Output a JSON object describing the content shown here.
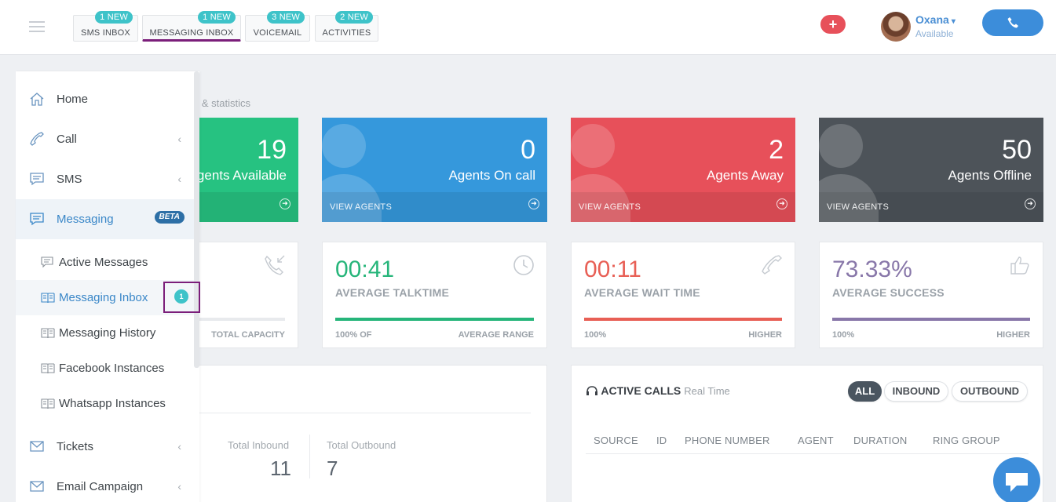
{
  "topbar": {
    "tabs": [
      {
        "label": "SMS INBOX",
        "badge": "1 NEW"
      },
      {
        "label": "MESSAGING INBOX",
        "badge": "1 NEW"
      },
      {
        "label": "VOICEMAIL",
        "badge": "3 NEW"
      },
      {
        "label": "ACTIVITIES",
        "badge": "2 NEW"
      }
    ],
    "plus": "+",
    "user": {
      "name": "Oxana",
      "status": "Available"
    }
  },
  "subtitle": "d & statistics",
  "cards": [
    {
      "value": "19",
      "label": "Agents Available",
      "color": "#26c281"
    },
    {
      "value": "0",
      "label": "Agents On call",
      "footer": "VIEW AGENTS",
      "color": "#3598dc"
    },
    {
      "value": "2",
      "label": "Agents Away",
      "footer": "VIEW AGENTS",
      "color": "#e7505a"
    },
    {
      "value": "50",
      "label": "Agents Offline",
      "footer": "VIEW AGENTS",
      "color": "#4d5359"
    }
  ],
  "metrics": [
    {
      "footer_right": "TOTAL CAPACITY"
    },
    {
      "value": "00:41",
      "label": "AVERAGE TALKTIME",
      "footer_left": "100% OF",
      "footer_right": "AVERAGE RANGE",
      "color": "#26b57a"
    },
    {
      "value": "00:11",
      "label": "AVERAGE WAIT TIME",
      "footer_left": "100%",
      "footer_right": "HIGHER",
      "color": "#e85f55"
    },
    {
      "value": "73.33%",
      "label": "AVERAGE SUCCESS",
      "footer_left": "100%",
      "footer_right": "HIGHER",
      "color": "#8877a9"
    }
  ],
  "totals": {
    "inbound_label": "Total Inbound",
    "inbound_value": "11",
    "outbound_label": "Total Outbound",
    "outbound_value": "7"
  },
  "active_calls": {
    "title": "ACTIVE CALLS",
    "subtitle": "Real Time",
    "filters": [
      "ALL",
      "INBOUND",
      "OUTBOUND"
    ],
    "columns": [
      "SOURCE",
      "ID",
      "PHONE NUMBER",
      "AGENT",
      "DURATION",
      "RING GROUP"
    ]
  },
  "sidebar": {
    "items": [
      {
        "label": "Home",
        "icon": "home-icon"
      },
      {
        "label": "Call",
        "icon": "phone-icon",
        "chevron": "‹"
      },
      {
        "label": "SMS",
        "icon": "sms-icon",
        "chevron": "‹"
      },
      {
        "label": "Messaging",
        "icon": "messaging-icon",
        "badge": "BETA"
      },
      {
        "label": "Tickets",
        "icon": "envelope-icon",
        "chevron": "‹"
      },
      {
        "label": "Email Campaign",
        "icon": "envelope-icon",
        "chevron": "‹"
      }
    ],
    "subitems": [
      {
        "label": "Active Messages"
      },
      {
        "label": "Messaging Inbox",
        "count": "1"
      },
      {
        "label": "Messaging History"
      },
      {
        "label": "Facebook Instances"
      },
      {
        "label": "Whatsapp Instances"
      }
    ]
  }
}
